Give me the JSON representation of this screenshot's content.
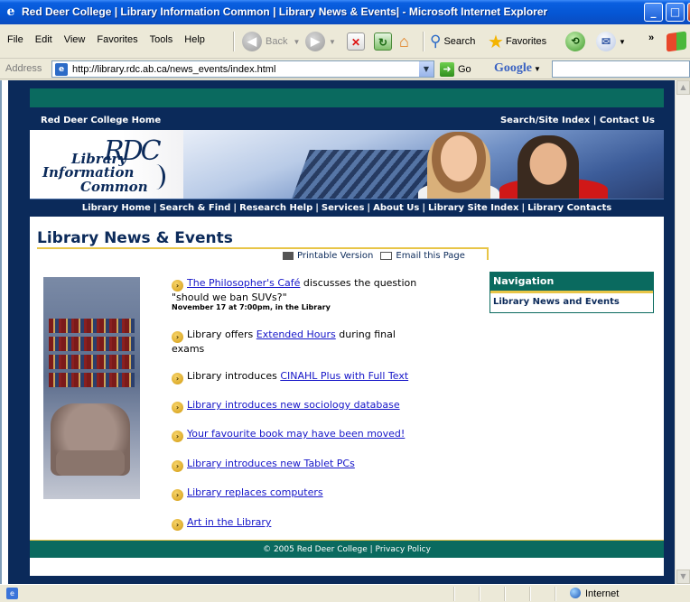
{
  "window": {
    "title": "Red Deer College | Library Information Common | Library News & Events| - Microsoft Internet Explorer"
  },
  "menu": [
    "File",
    "Edit",
    "View",
    "Favorites",
    "Tools",
    "Help"
  ],
  "toolbar": {
    "back": "Back",
    "search": "Search",
    "favorites": "Favorites",
    "more": "»"
  },
  "address": {
    "label": "Address",
    "url": "http://library.rdc.ab.ca/news_events/index.html",
    "go": "Go",
    "google": "Google"
  },
  "site": {
    "top_left": "Red Deer College Home",
    "top_right": "Search/Site Index | Contact Us",
    "logo": {
      "mark": "RDC",
      "line1": "Library",
      "line2": "Information",
      "line3": "Common"
    },
    "nav": [
      "Library Home",
      "Search & Find",
      "Research Help",
      "Services",
      "About Us",
      "Library Site Index",
      "Library Contacts"
    ],
    "page_title": "Library News & Events",
    "printable": "Printable Version",
    "email": "Email this Page",
    "news": [
      {
        "link": "The Philosopher's Café",
        "text": " discusses the question \"should we ban SUVs?\"",
        "date": "November 17 at 7:00pm, in the Library"
      },
      {
        "pre": "Library offers ",
        "link": "Extended Hours",
        "text": " during final exams"
      },
      {
        "pre": "Library introduces ",
        "link": "CINAHL Plus with Full Text"
      },
      {
        "link": "Library introduces new sociology database"
      },
      {
        "link": "Your favourite book may have been moved!"
      },
      {
        "link": "Library introduces new Tablet PCs"
      },
      {
        "link": "Library replaces computers"
      },
      {
        "link": "Art in the Library"
      }
    ],
    "sidebar": {
      "heading": "Navigation",
      "link": "Library News and Events"
    },
    "footer": "© 2005 Red Deer College | Privacy Policy"
  },
  "status": {
    "zone": "Internet"
  },
  "colors": {
    "navy": "#0b2a5a",
    "teal": "#0a6a5f",
    "gold": "#e8c547",
    "link": "#1515c8"
  }
}
